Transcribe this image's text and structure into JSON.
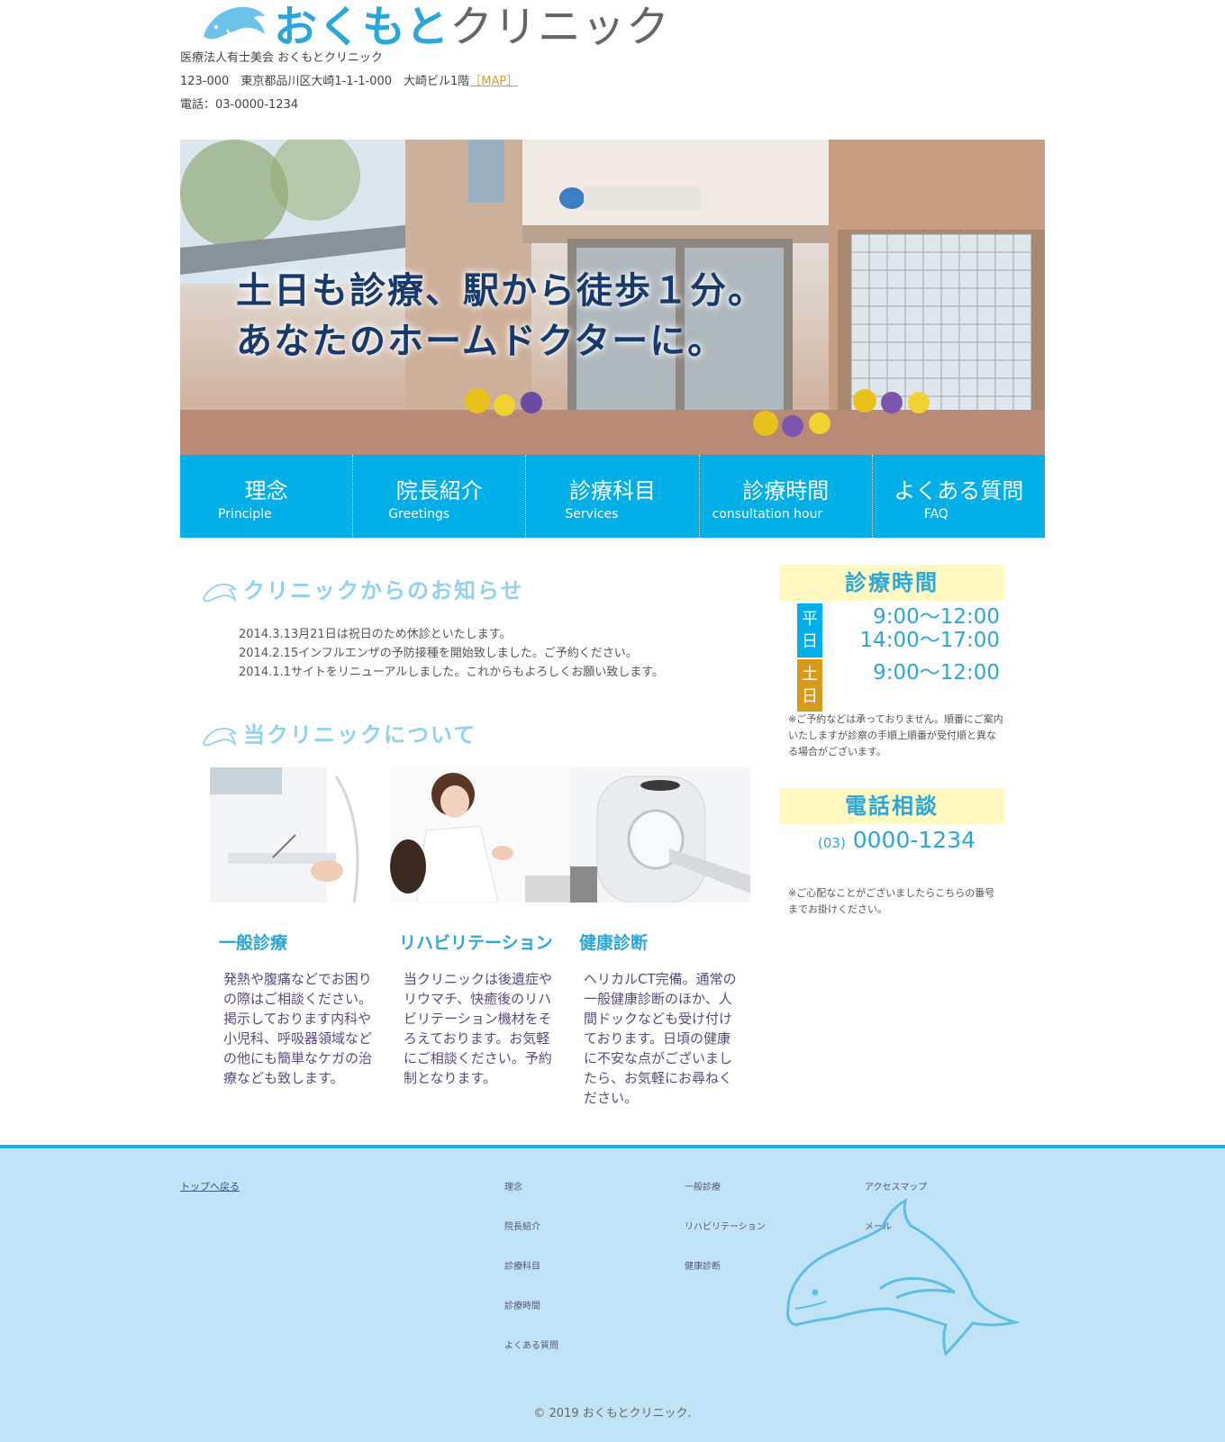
{
  "header": {
    "logo_jp_blue": "おくもと",
    "logo_jp_gray": "クリニック",
    "corp_name": "医療法人有士美会 おくもとクリニック",
    "address": "123-000　東京都品川区大崎1-1-1-000　大崎ビル1階",
    "map_link": "［MAP］",
    "phone": "電話：03-0000-1234"
  },
  "hero": {
    "line1": "土日も診療、駅から徒歩１分。",
    "line2": "あなたのホームドクターに。"
  },
  "nav": {
    "items": [
      {
        "jp": "理念",
        "en": "Principle"
      },
      {
        "jp": "院長紹介",
        "en": "Greetings"
      },
      {
        "jp": "診療科目",
        "en": "Services"
      },
      {
        "jp": "診療時間",
        "en": "consultation hour"
      },
      {
        "jp": "よくある質問",
        "en": "FAQ"
      }
    ]
  },
  "news": {
    "title": "クリニックからのお知らせ",
    "items": [
      "2014.3.13月21日は祝日のため休診といたします。",
      "2014.2.15インフルエンザの予防接種を開始致しました。ご予約ください。",
      "2014.1.1サイトをリニューアルしました。これからもよろしくお願い致します。"
    ]
  },
  "about": {
    "title": "当クリニックについて",
    "services": [
      {
        "title": "一般診療",
        "text": "発熱や腹痛などでお困りの際はご相談ください。掲示しております内科や小児科、呼吸器領域などの他にも簡単なケガの治療なども致します。"
      },
      {
        "title": "リハビリテーション",
        "text": "当クリニックは後遺症やリウマチ、快癒後のリハビリテーション機材をそろえております。お気軽にご相談ください。予約制となります。"
      },
      {
        "title": "健康診断",
        "text": "ヘリカルCT完備。通常の一般健康診断のほか、人間ドックなども受け付けております。日頃の健康に不安な点がございましたら、お気軽にお尋ねください。"
      }
    ]
  },
  "sidebar": {
    "hours_title": "診療時間",
    "weekday_label": "平日",
    "weekend_label": "土日",
    "weekday_am": "9:00～12:00",
    "weekday_pm": "14:00～17:00",
    "weekend_am": "9:00～12:00",
    "hours_note": "※ご予約などは承っておりません。順番にご案内いたしますが診察の手順上順番が受付順と異なる場合がございます。",
    "phone_title": "電話相談",
    "phone_prefix": "(03)",
    "phone_number": "0000-1234",
    "phone_note": "※ご心配なことがございましたらこちらの番号までお掛けください。"
  },
  "footer": {
    "back_to_top": "トップへ戻る",
    "col1": [
      "理念",
      "院長紹介",
      "診療科目",
      "診療時間",
      "よくある質問"
    ],
    "col2": [
      "一般診療",
      "リハビリテーション",
      "健康診断"
    ],
    "col3": [
      "アクセスマップ",
      "メール"
    ],
    "copyright": "© 2019 おくもとクリニック."
  },
  "colors": {
    "accent": "#00aee8",
    "title_light": "#8fd3ee",
    "weekday_tag": "#00aee8",
    "weekend_tag": "#d99a1a",
    "box_bg": "#fff8c1",
    "footer_bg": "#c0e4f5"
  }
}
